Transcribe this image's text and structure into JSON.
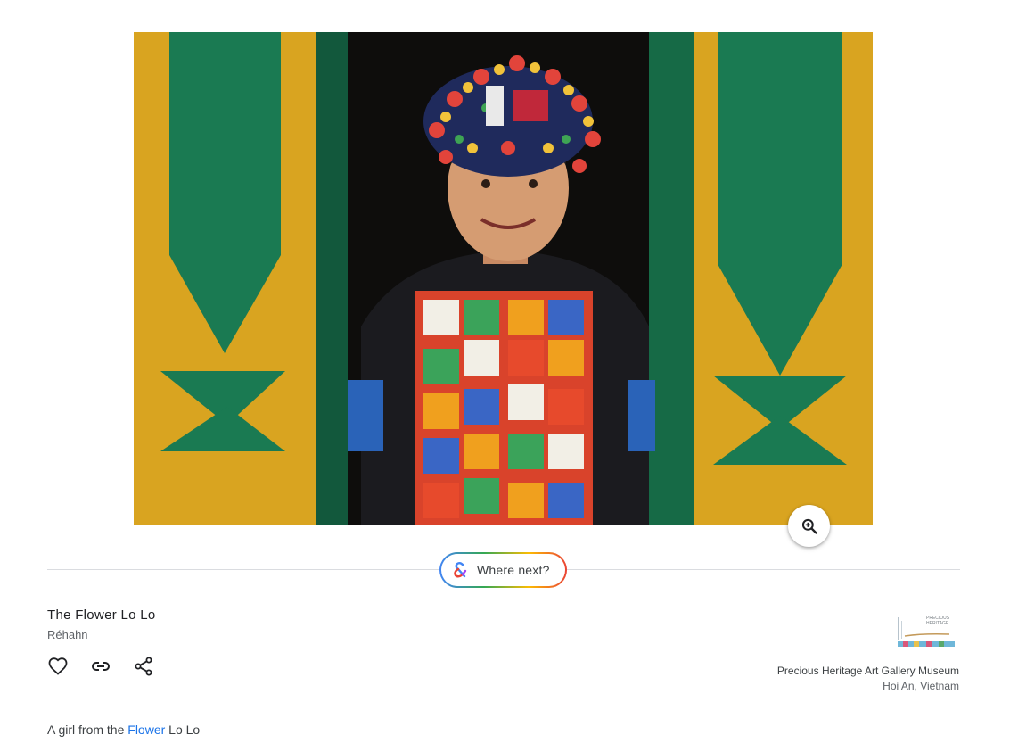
{
  "artwork": {
    "image_icon": "portrait-photo",
    "zoom_icon": "zoom-in-icon"
  },
  "where_next": {
    "label": "Where next?",
    "icon": "ampersand-icon"
  },
  "details": {
    "title": "The Flower Lo Lo",
    "creator": "Réhahn"
  },
  "actions": {
    "favorite_icon": "heart-icon",
    "link_icon": "link-icon",
    "share_icon": "share-icon"
  },
  "partner": {
    "logo_text": "PRECIOUS HERITAGE",
    "name": "Precious Heritage Art Gallery Museum",
    "location": "Hoi An, Vietnam"
  },
  "description": {
    "before": "A girl from the ",
    "link": "Flower",
    "after": " Lo Lo"
  },
  "colors": {
    "link": "#1a73e8",
    "divider": "#dadce0"
  }
}
